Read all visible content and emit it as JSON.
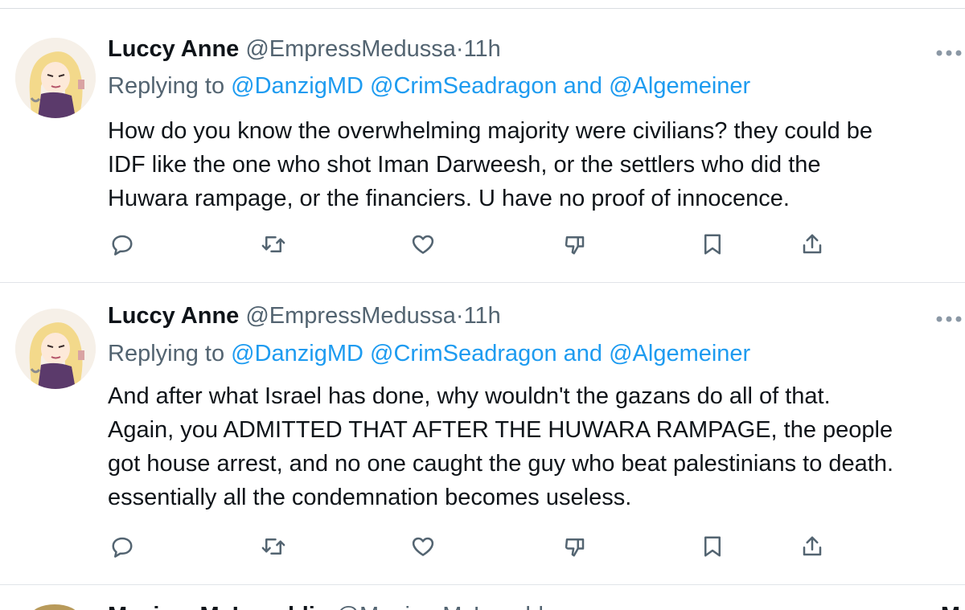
{
  "tweets": [
    {
      "name": "Luccy Anne",
      "handle": "@EmpressMedussa",
      "separator": "·",
      "time": "11h",
      "replying_prefix": "Replying to",
      "reply_handle_1": "@DanzigMD",
      "reply_handle_2": "@CrimSeadragon",
      "reply_and": "and",
      "reply_handle_3": "@Algemeiner",
      "text_lines": [
        "How do you know the overwhelming majority were civilians? they could be",
        "IDF like the one who shot Iman Darweesh, or the settlers who did the",
        "Huwara rampage, or the financiers. U have no proof of innocence."
      ]
    },
    {
      "name": "Luccy Anne",
      "handle": "@EmpressMedussa",
      "separator": "·",
      "time": "11h",
      "replying_prefix": "Replying to",
      "reply_handle_1": "@DanzigMD",
      "reply_handle_2": "@CrimSeadragon",
      "reply_and": "and",
      "reply_handle_3": "@Algemeiner",
      "text_lines": [
        "And after what Israel has done, why wouldn't the gazans do all of that.",
        "Again, you ADMITTED THAT AFTER THE HUWARA RAMPAGE, the people",
        "got house arrest, and no one caught the guy who beat palestinians to death.",
        "essentially all the condemnation becomes useless."
      ]
    }
  ],
  "next_tweet_peek": {
    "name": "Maaiam McLaughlin",
    "handle": "@MaaiamMcLaughl",
    "more": "M"
  },
  "icons": {
    "reply": "reply-icon",
    "retweet": "retweet-icon",
    "like": "heart-icon",
    "dislike": "thumbs-down-icon",
    "bookmark": "bookmark-icon",
    "share": "share-icon",
    "more": "more-dots-icon"
  },
  "colors": {
    "text": "#0f1419",
    "secondary": "#536471",
    "link": "#1d9bf0",
    "icon": "#536471",
    "divider": "#e1e4e8"
  }
}
